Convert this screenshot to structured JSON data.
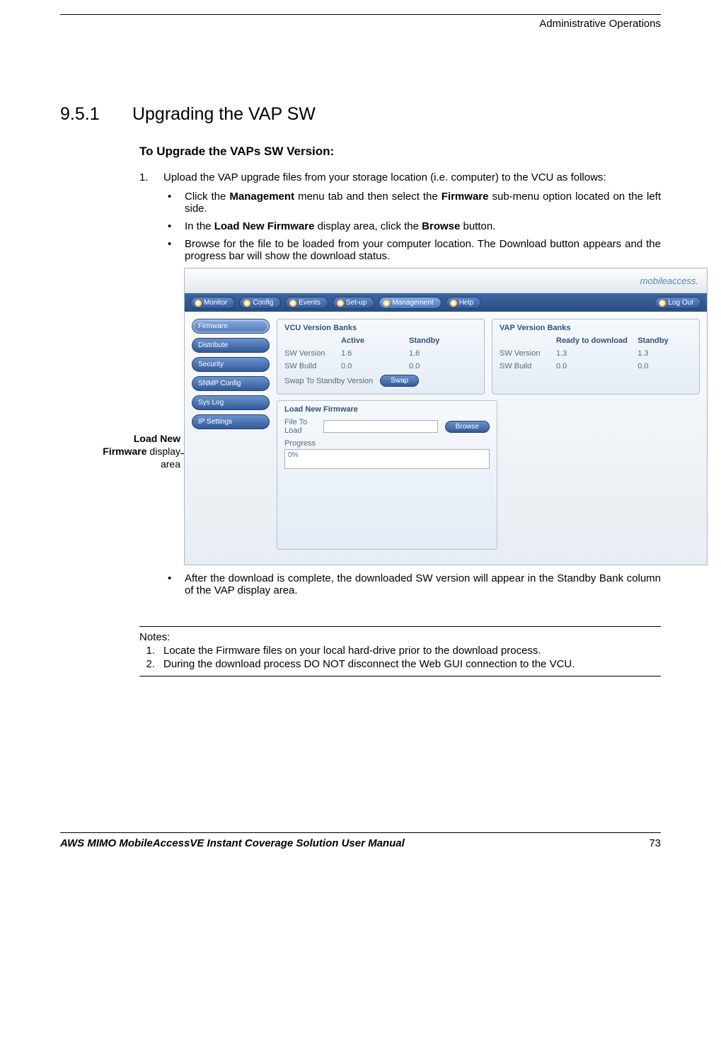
{
  "header": {
    "right": "Administrative Operations"
  },
  "section": {
    "number": "9.5.1",
    "title": "Upgrading the VAP SW"
  },
  "subheading": "To Upgrade the VAPs SW Version:",
  "step1": {
    "num": "1.",
    "text": "Upload the VAP upgrade files from your storage location (i.e. computer) to the VCU as follows:"
  },
  "bullets_a": {
    "b1_pre": "Click the ",
    "b1_bold1": "Management",
    "b1_mid": " menu tab and then select the ",
    "b1_bold2": "Firmware",
    "b1_post": " sub-menu option located on the left side.",
    "b2_pre": "In the ",
    "b2_bold1": "Load New Firmware",
    "b2_mid": " display area, click the ",
    "b2_bold2": "Browse",
    "b2_post": " button.",
    "b3": "Browse for the file to be loaded from your computer location. The Download button appears and the progress bar will show the download status."
  },
  "callout": {
    "line1_bold": "Load New",
    "line2_bold": "Firmware",
    "line2_rest": " display",
    "line3": "area"
  },
  "app": {
    "brand": "mobileaccess",
    "nav": [
      "Monitor",
      "Config",
      "Events",
      "Set-up",
      "Management",
      "Help"
    ],
    "logout": "Log Out",
    "side": [
      "Firmware",
      "Distribute",
      "Security",
      "SNMP Config",
      "Sys Log",
      "IP Settings"
    ],
    "vcu": {
      "title": "VCU Version Banks",
      "active": "Active",
      "standby": "Standby",
      "swv": "SW Version",
      "swb": "SW Build",
      "v_a": "1.6",
      "v_s": "1.6",
      "b_a": "0.0",
      "b_s": "0.0",
      "swap_label": "Swap To Standby Version",
      "swap_btn": "Swap"
    },
    "vap": {
      "title": "VAP Version Banks",
      "ready": "Ready to download",
      "standby": "Standby",
      "swv": "SW Version",
      "swb": "SW Build",
      "v_r": "1.3",
      "v_s": "1.3",
      "b_r": "0.0",
      "b_s": "0.0"
    },
    "lnf": {
      "title": "Load New Firmware",
      "file_label": "File To Load",
      "browse": "Browse",
      "progress_label": "Progress",
      "progress_value": "0%"
    }
  },
  "bullets_b": {
    "b4": "After the download is complete, the downloaded SW version will appear in the Standby Bank column of the VAP display area."
  },
  "notes": {
    "title": "Notes:",
    "n1_num": "1.",
    "n1": "Locate the Firmware files on your local hard-drive prior to the download process.",
    "n2_num": "2.",
    "n2": "During the download process DO NOT disconnect the Web GUI connection to the VCU."
  },
  "footer": {
    "left": "AWS MIMO MobileAccessVE Instant Coverage Solution User Manual",
    "right": "73"
  }
}
